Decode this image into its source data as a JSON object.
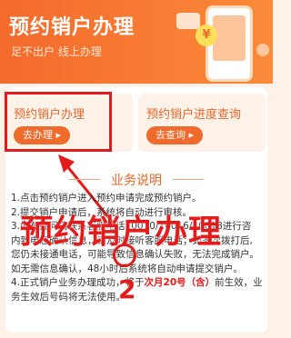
{
  "banner": {
    "title": "预约销户办理",
    "subtitle": "足不出户 线上办理",
    "badge": "¥"
  },
  "cards": [
    {
      "title": "预约销户办理",
      "button": "去办理 ▸"
    },
    {
      "title": "预约销户进度查询",
      "button": "去查询 ▸"
    }
  ],
  "section": {
    "title": "业务说明"
  },
  "body_lines": [
    "1.点击预约销户进入预约申请完成预约销户。",
    "2.提交销户申请后，系统将自动进行审核。",
    "3.如有疑问请联系客服电话10010/10016/10018进行咨",
    "内致电您确认信息，请及时接听客服电话；如多次拨打后,",
    "您仍未接通电话，可能导致信息确认失败，无法完成销户。",
    "如无需信息确认，48小时后系统将自动申请提交销户。",
    "4.正式销户业务办理成功，将于",
    "务生效后号码将无法使用。"
  ],
  "highlight": "次月20号（含）",
  "line7_tail": "前生效，业",
  "overlay": {
    "text": "预约销户办理",
    "number": "2"
  },
  "colors": {
    "brand": "#f46a2c",
    "annotation": "#e41b1b"
  }
}
